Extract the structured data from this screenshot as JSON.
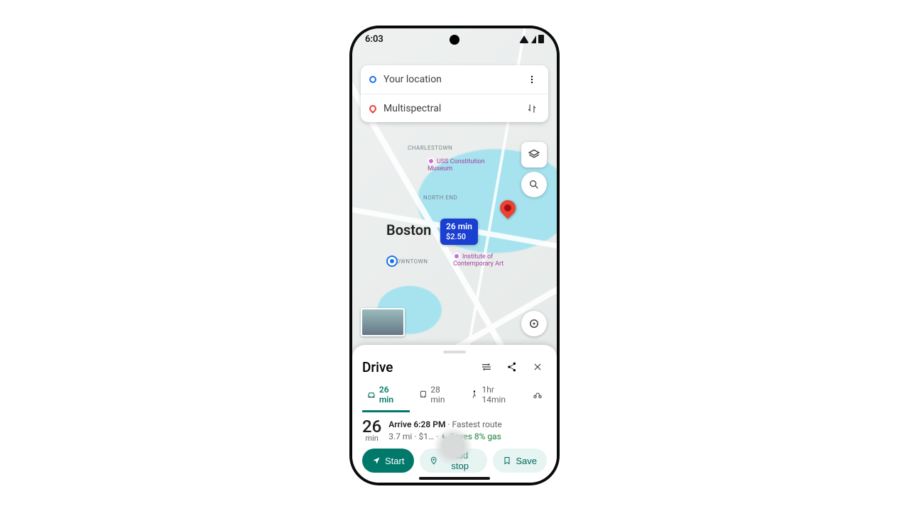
{
  "statusbar": {
    "time": "6:03"
  },
  "search": {
    "origin": "Your location",
    "destination": "Multispectral"
  },
  "map": {
    "city_label": "Boston",
    "neighborhoods": {
      "charlestown": "CHARLESTOWN",
      "north_end": "NORTH END",
      "downtown": "DOWNTOWN"
    },
    "pois": {
      "uss": "USS Constitution Museum",
      "ica": "Institute of Contemporary Art"
    },
    "route_badge": {
      "duration": "26 min",
      "cost": "$2.50"
    }
  },
  "sheet": {
    "title": "Drive",
    "modes": {
      "drive": "26 min",
      "transit": "28 min",
      "walk": "1hr 14min"
    },
    "summary": {
      "big_num": "26",
      "big_unit": "min",
      "arrival": "Arrive 6:28 PM",
      "arrival_note": "Fastest route",
      "distance": "3.7 mi",
      "cost": "$1…",
      "savings": "Saves 8% gas"
    },
    "actions": {
      "start": "Start",
      "addstop": "Add stop",
      "save": "Save"
    }
  }
}
